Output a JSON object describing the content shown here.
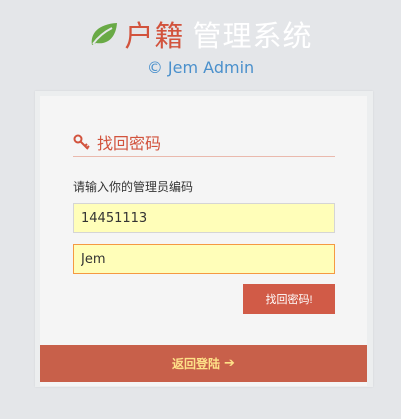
{
  "header": {
    "title_highlight": "户籍",
    "title_rest": "管理系统",
    "subtitle": "© Jem Admin"
  },
  "panel": {
    "title": "找回密码",
    "prompt": "请输入你的管理员编码",
    "field_code_value": "14451113",
    "field_name_value": "Jem",
    "submit_label": "找回密码!"
  },
  "footer": {
    "back_label": "返回登陆",
    "back_arrow": "➔"
  },
  "icons": {
    "logo": "leaf-icon",
    "panel": "key-icon",
    "back": "arrow-right-icon"
  },
  "colors": {
    "accent": "#d2533d",
    "footer": "#c8604a",
    "link": "#fee188",
    "field_bg": "#fffeb9",
    "subtitle": "#4a90cc"
  }
}
